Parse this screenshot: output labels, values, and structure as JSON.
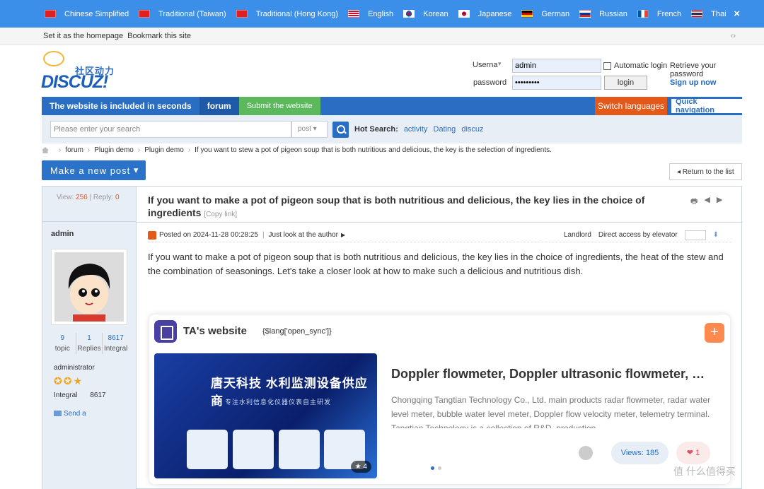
{
  "langbar": {
    "languages": [
      {
        "label": "Chinese Simplified",
        "flag": "cn-flag"
      },
      {
        "label": "Traditional (Taiwan)",
        "flag": "cn-flag"
      },
      {
        "label": "Traditional (Hong Kong)",
        "flag": "cn-flag"
      },
      {
        "label": "English",
        "flag": "us-flag"
      },
      {
        "label": "Korean",
        "flag": "kr-flag"
      },
      {
        "label": "Japanese",
        "flag": "jp-flag"
      },
      {
        "label": "German",
        "flag": "de-flag"
      },
      {
        "label": "Russian",
        "flag": "ru-flag"
      },
      {
        "label": "French",
        "flag": "fr-flag"
      },
      {
        "label": "Thai",
        "flag": "th-flag"
      }
    ],
    "close": "×",
    "color": "#3b8fe8"
  },
  "topbar": {
    "homepage": "Set it as the homepage",
    "bookmark": "Bookmark this site",
    "code_icon": "‹›"
  },
  "logo": {
    "cn": "社区动力",
    "en": "DISCUZ!"
  },
  "login": {
    "username_label": "Userna",
    "username_value": "admin",
    "password_label": "password",
    "password_value": "•••••••••",
    "auto_login": "Automatic login",
    "retrieve": "Retrieve your password",
    "login_button": "login",
    "signup": "Sign up now"
  },
  "nav": {
    "items": [
      "The website is included in seconds",
      "forum",
      "Submit the website"
    ],
    "switch_lang": "Switch languages",
    "quick_nav": "Quick navigation",
    "primary_color": "#2a6ec4"
  },
  "search": {
    "placeholder": "Please enter your search",
    "type": "post",
    "hot_label": "Hot Search:",
    "hot_terms": [
      "activity",
      "Dating",
      "discuz"
    ]
  },
  "breadcrumb": {
    "items": [
      "forum",
      "Plugin demo",
      "Plugin demo",
      "If you want to stew a pot of pigeon soup that is both nutritious and delicious, the key is the selection of ingredients."
    ]
  },
  "actions": {
    "new_post": "Make a new post",
    "return": "Return to the list"
  },
  "thread": {
    "view_label": "View:",
    "views": "256",
    "reply_label": "Reply:",
    "replies": "0",
    "title": "If you want to make a pot of pigeon soup that is both nutritious and delicious, the key lies in the choice of ingredients",
    "copy_link": "[Copy link]"
  },
  "author": {
    "name": "admin",
    "topics": "9",
    "topics_label": "topic",
    "replies": "1",
    "replies_label": "Replies",
    "integral": "8617",
    "integral_label": "Integral",
    "role": "administrator",
    "stars": "✪✪★",
    "integral_row_label": "Integral",
    "integral_row_value": "8617",
    "send": "Send a"
  },
  "post": {
    "posted_on": "Posted on 2024-11-28 00:28:25",
    "only_author": "Just look at the author",
    "landlord": "Landlord",
    "elevator": "Direct access by elevator",
    "body": "If you want to make a pot of pigeon soup that is both nutritious and delicious, the key lies in the choice of ingredients, the heat of the stew and the combination of seasonings. Let's take a closer look at how to make such a delicious and nutritious dish."
  },
  "card": {
    "title": "TA's website",
    "sync": "{$lang['open_sync']}",
    "plus": "+",
    "banner_cn": "唐天科技 水利监测设备供应商",
    "banner_sub": "专注水利信息化仪器仪表自主研发",
    "rating": "★ 4",
    "product_title": "Doppler flowmeter, Doppler ultrasonic flowmeter, Ultrasonic Doppler flowmeter",
    "product_desc": "Chongqing Tangtian Technology Co., Ltd. main products radar flowmeter, radar water level meter, bubble water level meter, Doppler flow velocity meter, telemetry terminal. Tangtian Technology is a collection of R&D, production",
    "views": "Views: 185",
    "likes": "1"
  },
  "watermark": "值 什么值得买"
}
